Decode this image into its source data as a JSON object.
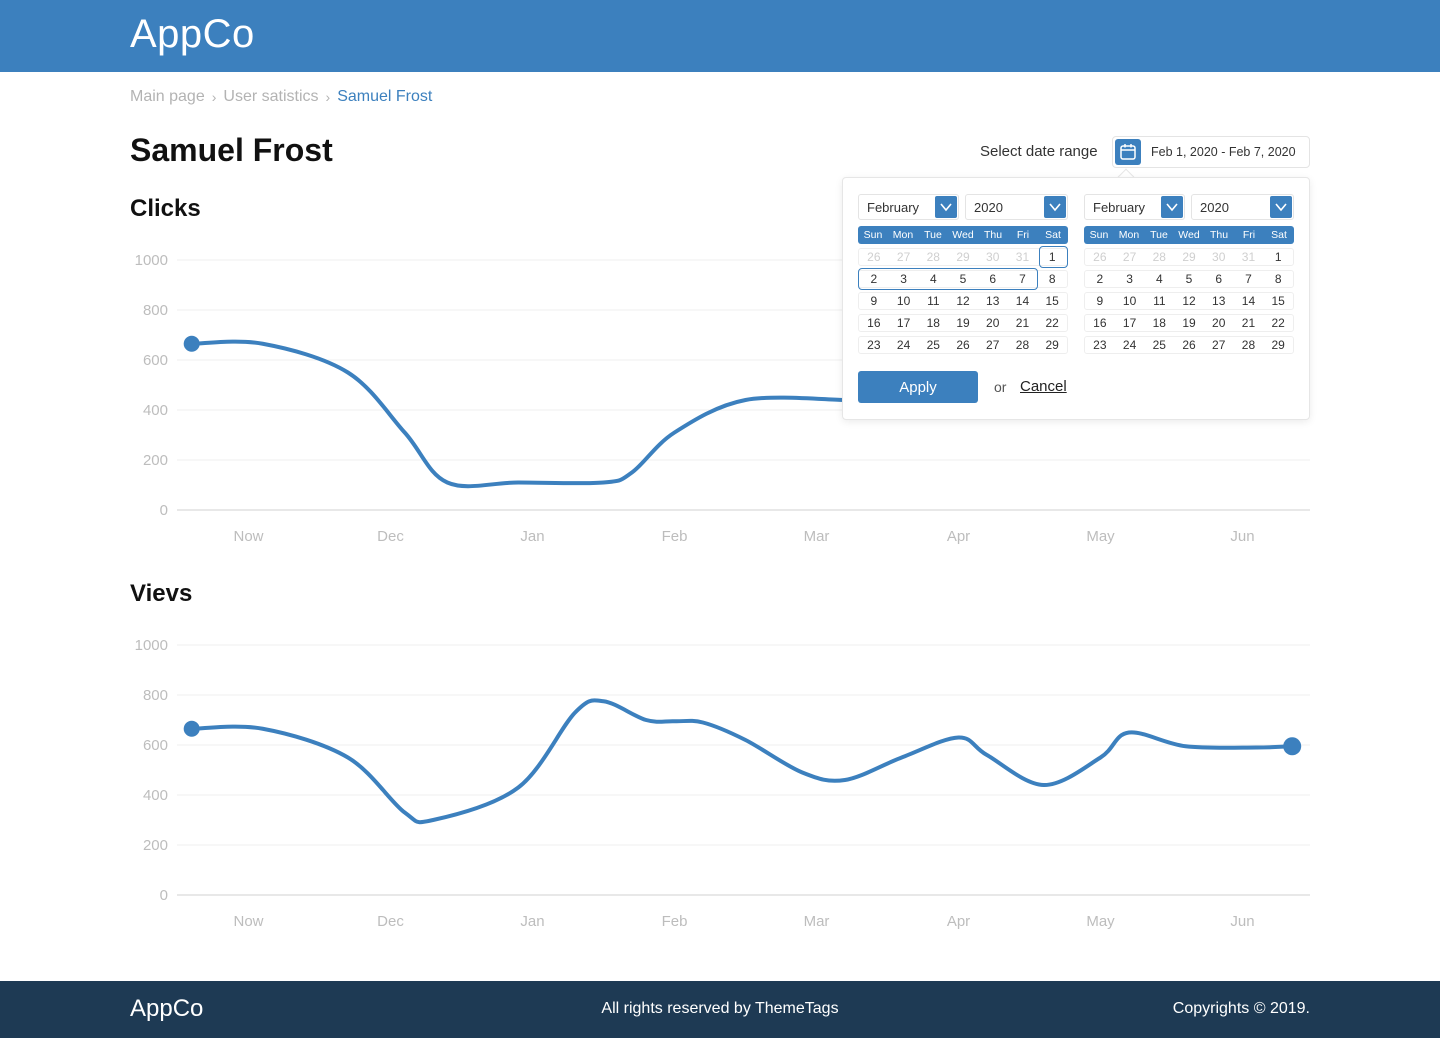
{
  "app": {
    "title": "AppCo"
  },
  "breadcrumb": [
    {
      "label": "Main page"
    },
    {
      "label": "User satistics"
    },
    {
      "label": "Samuel Frost"
    }
  ],
  "page": {
    "title": "Samuel Frost"
  },
  "date_range": {
    "label": "Select date range",
    "value": "Feb 1, 2020 - Feb 7, 2020",
    "icon": "calendar-icon"
  },
  "datepicker": {
    "weekdays": [
      "Sun",
      "Mon",
      "Tue",
      "Wed",
      "Thu",
      "Fri",
      "Sat"
    ],
    "calendars": [
      {
        "month": "February",
        "year": "2020",
        "weeks": [
          [
            "26",
            "27",
            "28",
            "29",
            "30",
            "31",
            "1"
          ],
          [
            "2",
            "3",
            "4",
            "5",
            "6",
            "7",
            "8"
          ],
          [
            "9",
            "10",
            "11",
            "12",
            "13",
            "14",
            "15"
          ],
          [
            "16",
            "17",
            "18",
            "19",
            "20",
            "21",
            "22"
          ],
          [
            "23",
            "24",
            "25",
            "26",
            "27",
            "28",
            "29"
          ]
        ],
        "muted_first_week_count": 6
      },
      {
        "month": "February",
        "year": "2020",
        "weeks": [
          [
            "26",
            "27",
            "28",
            "29",
            "30",
            "31",
            "1"
          ],
          [
            "2",
            "3",
            "4",
            "5",
            "6",
            "7",
            "8"
          ],
          [
            "9",
            "10",
            "11",
            "12",
            "13",
            "14",
            "15"
          ],
          [
            "16",
            "17",
            "18",
            "19",
            "20",
            "21",
            "22"
          ],
          [
            "23",
            "24",
            "25",
            "26",
            "27",
            "28",
            "29"
          ]
        ],
        "muted_first_week_count": 6
      }
    ],
    "apply_label": "Apply",
    "or_label": "or",
    "cancel_label": "Cancel"
  },
  "sections": {
    "clicks_title": "Clicks",
    "views_title": "Vievs"
  },
  "chart_data": [
    {
      "type": "line",
      "title": "Clicks",
      "categories": [
        "Now",
        "Dec",
        "Jan",
        "Feb",
        "Mar",
        "Apr",
        "May",
        "Jun"
      ],
      "yticks": [
        "1000",
        "800",
        "600",
        "400",
        "200",
        "0"
      ],
      "ylim": [
        0,
        1000
      ],
      "x": [
        -0.4,
        0.1,
        0.7,
        1.1,
        1.4,
        1.9,
        2.5,
        2.7,
        3.0,
        3.5,
        4.2
      ],
      "values": [
        665,
        665,
        550,
        310,
        110,
        110,
        110,
        150,
        310,
        440,
        440
      ],
      "color": "#3c80be"
    },
    {
      "type": "line",
      "title": "Vievs",
      "categories": [
        "Now",
        "Dec",
        "Jan",
        "Feb",
        "Mar",
        "Apr",
        "May",
        "Jun"
      ],
      "yticks": [
        "1000",
        "800",
        "600",
        "400",
        "200",
        "0"
      ],
      "ylim": [
        0,
        1000
      ],
      "x": [
        -0.4,
        0.1,
        0.7,
        1.1,
        1.3,
        1.9,
        2.3,
        2.5,
        2.8,
        3.0,
        3.2,
        3.5,
        3.9,
        4.2,
        4.6,
        5.0,
        5.2,
        5.6,
        6.0,
        6.2,
        6.6,
        7.1,
        7.35
      ],
      "values": [
        665,
        665,
        550,
        330,
        300,
        430,
        730,
        775,
        700,
        695,
        690,
        620,
        490,
        460,
        550,
        630,
        560,
        440,
        550,
        650,
        595,
        590,
        595
      ],
      "color": "#3c80be"
    }
  ],
  "footer": {
    "logo": "AppCo",
    "rights": "All rights reserved by ThemeTags",
    "copyright": "Copyrights © 2019."
  }
}
